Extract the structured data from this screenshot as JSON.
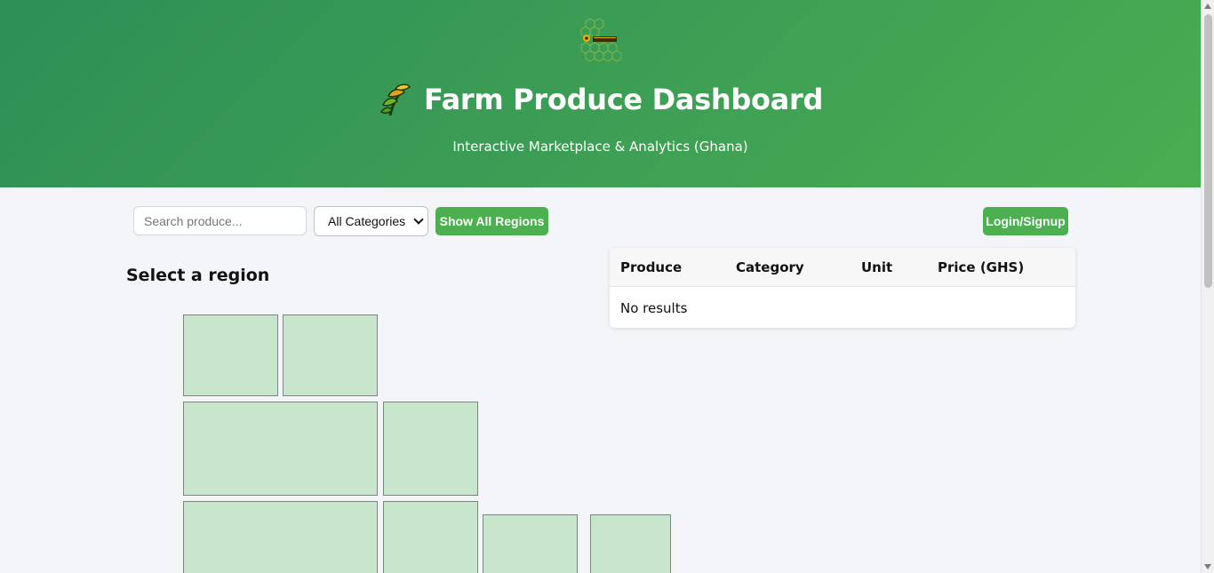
{
  "header": {
    "title": "Farm Produce Dashboard",
    "subtitle": "Interactive Marketplace & Analytics (Ghana)",
    "logo_icon": "honeycomb-logo-icon",
    "title_icon": "wheat-icon"
  },
  "toolbar": {
    "search_placeholder": "Search produce...",
    "category_selected": "All Categories",
    "show_regions_label": "Show All Regions",
    "login_label": "Login/Signup"
  },
  "map": {
    "heading": "Select a region",
    "region_count": 8
  },
  "table": {
    "columns": [
      "Produce",
      "Category",
      "Unit",
      "Price (GHS)"
    ],
    "empty_message": "No results"
  },
  "colors": {
    "header_gradient_start": "#2e8f57",
    "header_gradient_end": "#4aad50",
    "accent": "#4caf50",
    "region_fill": "#c8e6cc"
  }
}
